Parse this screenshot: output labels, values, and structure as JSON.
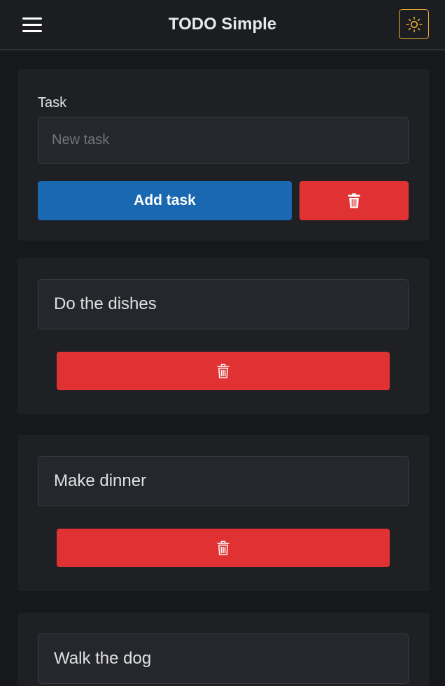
{
  "header": {
    "title": "TODO Simple",
    "menu_icon": "hamburger-menu-icon",
    "theme_icon": "sun-icon",
    "theme_accent": "#f2b233"
  },
  "form": {
    "label": "Task",
    "placeholder": "New task",
    "value": "",
    "add_label": "Add task",
    "clear_icon": "trash-icon"
  },
  "tasks": [
    {
      "text": "Do the dishes",
      "delete_icon": "trash-outline-icon"
    },
    {
      "text": "Make dinner",
      "delete_icon": "trash-outline-icon"
    },
    {
      "text": "Walk the dog",
      "delete_icon": "trash-outline-icon"
    }
  ],
  "colors": {
    "background": "#17181b",
    "card": "#1f2024",
    "primary": "#1a68b2",
    "danger": "#e03232"
  }
}
